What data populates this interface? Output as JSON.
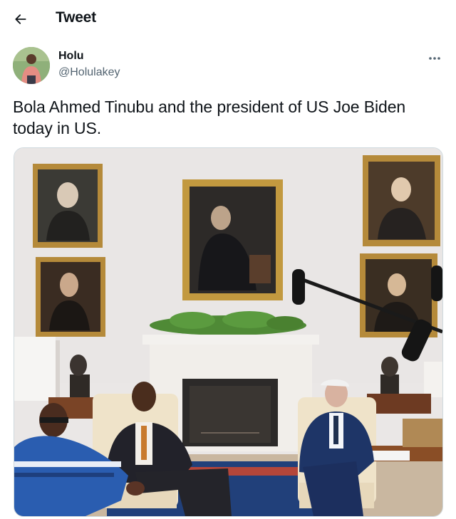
{
  "header": {
    "back_icon": "arrow-left-icon",
    "title": "Tweet"
  },
  "author": {
    "display_name": "Holu",
    "handle": "@Holulakey",
    "more_icon": "more-horizontal-icon"
  },
  "tweet": {
    "text": "Bola Ahmed Tinubu and the president of US Joe Biden today in US."
  },
  "colors": {
    "text_primary": "#0f1419",
    "text_secondary": "#536471",
    "border": "#cfd9de"
  }
}
